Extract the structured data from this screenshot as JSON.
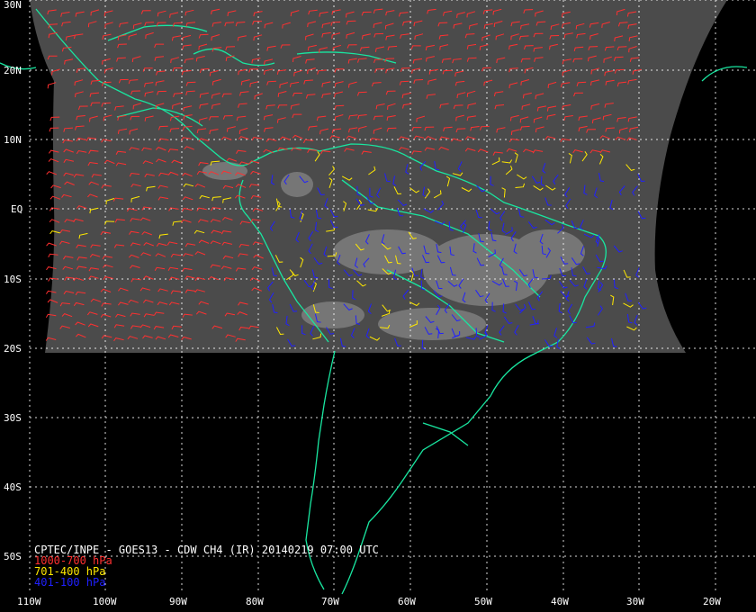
{
  "title": "CPTEC/INPE - GOES13 - CDW CH4 (IR) 20140219 07:00 UTC",
  "legend": [
    {
      "label": "1000-700 hPa",
      "color": "#ff3030"
    },
    {
      "label": "701-400 hPa",
      "color": "#ffe800"
    },
    {
      "label": "401-100 hPa",
      "color": "#2020ff"
    }
  ],
  "lat_labels": [
    "30N",
    "20N",
    "10N",
    "EQ",
    "10S",
    "20S",
    "30S",
    "40S",
    "50S"
  ],
  "lon_labels": [
    "110W",
    "100W",
    "90W",
    "80W",
    "70W",
    "60W",
    "50W",
    "40W",
    "30W",
    "20W"
  ],
  "colors": {
    "background": "#000000",
    "grid": "#ffffff",
    "coastline": "#19e6a0",
    "satellite_imagery": "#4a4a4a"
  }
}
